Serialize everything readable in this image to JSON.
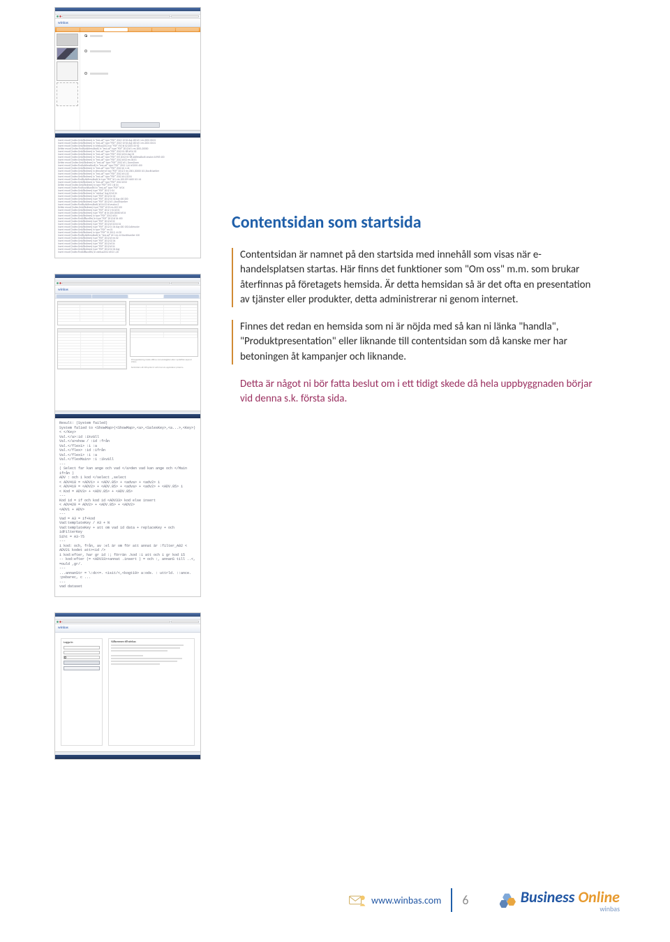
{
  "heading": "Contentsidan som startsida",
  "para1": "Contentsidan är namnet på den startsida med innehåll som visas när e-handelsplatsen startas. Här finns det funktioner som \"Om oss\" m.m. som brukar återfinnas på företagets hemsida. Är detta hemsidan så är det ofta en presentation av tjänster eller produkter, detta administrerar ni genom internet.",
  "para2": "Finnes det redan en hemsida som ni är nöjda med så kan ni länka \"handla\", \"Produktpresentation\" eller liknande till contentsidan som då kanske mer har betoningen åt kampanjer och liknande.",
  "note": "Detta är något ni bör fatta beslut om i ett tidigt skede då hela uppbyggnaden börjar vid denna s.k. första sida.",
  "mini_brand": "winbas",
  "login": {
    "title": "Logga in",
    "info_title": "Välkommen till winbas"
  },
  "footer": {
    "url": "www.winbas.com",
    "page": "6",
    "brand_a": "Business",
    "brand_b": "Online",
    "brand_sub": "winbas"
  }
}
